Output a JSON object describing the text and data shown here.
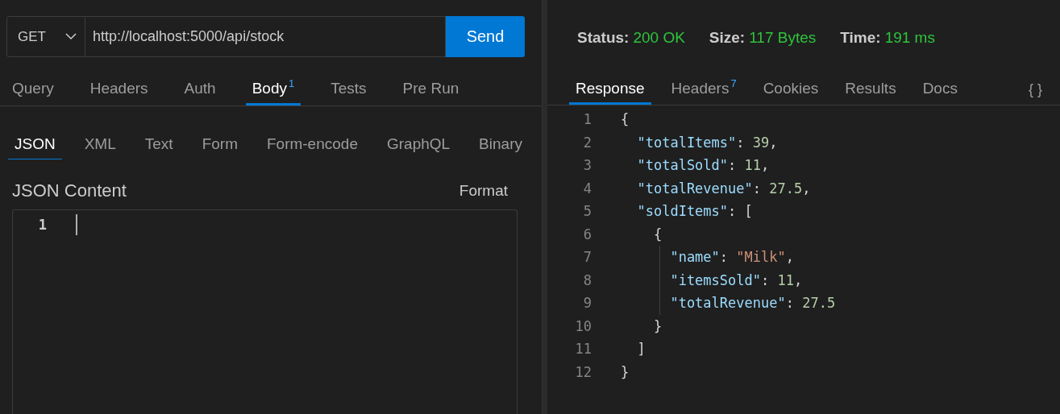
{
  "request": {
    "method": "GET",
    "url": "http://localhost:5000/api/stock",
    "send": "Send"
  },
  "request_tabs": [
    {
      "label": "Query",
      "selected": false
    },
    {
      "label": "Headers",
      "selected": false
    },
    {
      "label": "Auth",
      "selected": false
    },
    {
      "label": "Body",
      "badge": "1",
      "selected": true
    },
    {
      "label": "Tests",
      "selected": false
    },
    {
      "label": "Pre Run",
      "selected": false
    }
  ],
  "body_tabs": [
    {
      "label": "JSON",
      "selected": true
    },
    {
      "label": "XML",
      "selected": false
    },
    {
      "label": "Text",
      "selected": false
    },
    {
      "label": "Form",
      "selected": false
    },
    {
      "label": "Form-encode",
      "selected": false
    },
    {
      "label": "GraphQL",
      "selected": false
    },
    {
      "label": "Binary",
      "selected": false
    }
  ],
  "body_editor": {
    "title": "JSON Content",
    "format": "Format",
    "line_numbers": [
      "1"
    ]
  },
  "status": [
    {
      "label": "Status:",
      "value": "200 OK"
    },
    {
      "label": "Size:",
      "value": "117 Bytes"
    },
    {
      "label": "Time:",
      "value": "191 ms"
    }
  ],
  "response_tabs": [
    {
      "label": "Response",
      "selected": true
    },
    {
      "label": "Headers",
      "badge": "7",
      "selected": false
    },
    {
      "label": "Cookies",
      "selected": false
    },
    {
      "label": "Results",
      "selected": false
    },
    {
      "label": "Docs",
      "selected": false
    }
  ],
  "response_view_toggle": "{ }",
  "response_lines": [
    {
      "number": "1",
      "indent_guide": false,
      "tokens": [
        {
          "kind": "punct",
          "text": "{"
        }
      ]
    },
    {
      "number": "2",
      "indent_guide": false,
      "tokens": [
        {
          "kind": "key",
          "text": "  \"totalItems\""
        },
        {
          "kind": "punct",
          "text": ": "
        },
        {
          "kind": "number",
          "text": "39"
        },
        {
          "kind": "punct",
          "text": ","
        }
      ]
    },
    {
      "number": "3",
      "indent_guide": false,
      "tokens": [
        {
          "kind": "key",
          "text": "  \"totalSold\""
        },
        {
          "kind": "punct",
          "text": ": "
        },
        {
          "kind": "number",
          "text": "11"
        },
        {
          "kind": "punct",
          "text": ","
        }
      ]
    },
    {
      "number": "4",
      "indent_guide": false,
      "tokens": [
        {
          "kind": "key",
          "text": "  \"totalRevenue\""
        },
        {
          "kind": "punct",
          "text": ": "
        },
        {
          "kind": "number",
          "text": "27.5"
        },
        {
          "kind": "punct",
          "text": ","
        }
      ]
    },
    {
      "number": "5",
      "indent_guide": false,
      "tokens": [
        {
          "kind": "key",
          "text": "  \"soldItems\""
        },
        {
          "kind": "punct",
          "text": ": ["
        }
      ]
    },
    {
      "number": "6",
      "indent_guide": false,
      "tokens": [
        {
          "kind": "punct",
          "text": "    {"
        }
      ]
    },
    {
      "number": "7",
      "indent_guide": true,
      "tokens": [
        {
          "kind": "key",
          "text": "      \"name\""
        },
        {
          "kind": "punct",
          "text": ": "
        },
        {
          "kind": "string",
          "text": "\"Milk\""
        },
        {
          "kind": "punct",
          "text": ","
        }
      ]
    },
    {
      "number": "8",
      "indent_guide": true,
      "tokens": [
        {
          "kind": "key",
          "text": "      \"itemsSold\""
        },
        {
          "kind": "punct",
          "text": ": "
        },
        {
          "kind": "number",
          "text": "11"
        },
        {
          "kind": "punct",
          "text": ","
        }
      ]
    },
    {
      "number": "9",
      "indent_guide": true,
      "tokens": [
        {
          "kind": "key",
          "text": "      \"totalRevenue\""
        },
        {
          "kind": "punct",
          "text": ": "
        },
        {
          "kind": "number",
          "text": "27.5"
        }
      ]
    },
    {
      "number": "10",
      "indent_guide": false,
      "tokens": [
        {
          "kind": "punct",
          "text": "    }"
        }
      ]
    },
    {
      "number": "11",
      "indent_guide": false,
      "tokens": [
        {
          "kind": "punct",
          "text": "  ]"
        }
      ]
    },
    {
      "number": "12",
      "indent_guide": false,
      "tokens": [
        {
          "kind": "punct",
          "text": "}"
        }
      ]
    }
  ]
}
